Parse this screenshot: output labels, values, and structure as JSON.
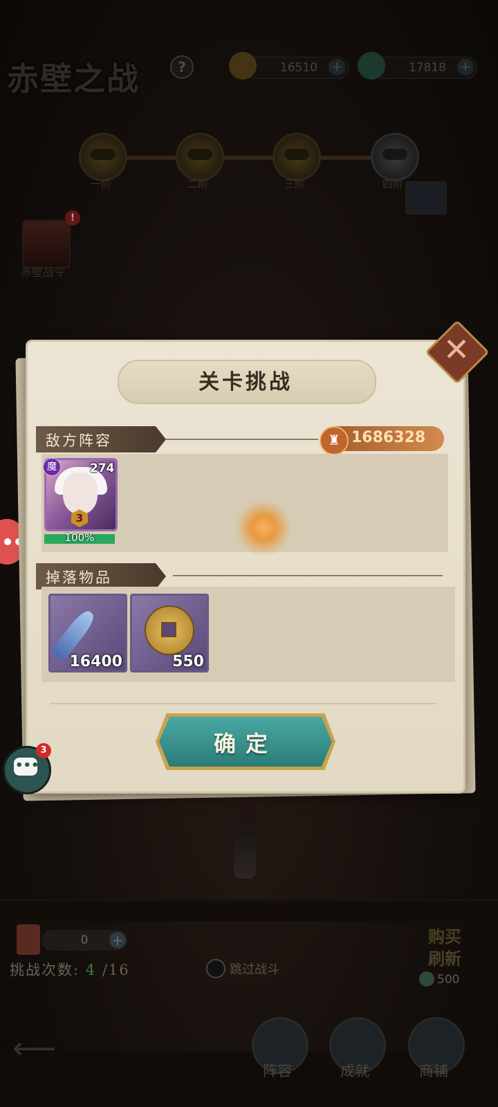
{
  "header": {
    "title": "赤壁之战",
    "help_icon": "?",
    "currency1": {
      "icon": "coin-icon",
      "value": "16510",
      "plus": "+"
    },
    "currency2": {
      "icon": "jade-dragon-icon",
      "value": "17818",
      "plus": "+"
    }
  },
  "stages": [
    {
      "label": "一阶",
      "locked": false
    },
    {
      "label": "二阶",
      "locked": false
    },
    {
      "label": "三阶",
      "locked": false
    },
    {
      "label": "四阶",
      "locked": true
    }
  ],
  "side_event": {
    "label": "赤壁战令",
    "badge": "!"
  },
  "dialog": {
    "title": "关卡挑战",
    "enemy_section": "敌方阵容",
    "power_icon": "power-icon",
    "power_value": "1686328",
    "enemy": {
      "faction": "魔",
      "level": "274",
      "stars": "3",
      "hp_percent": 100,
      "hp_text": "100%"
    },
    "drops_section": "掉落物品",
    "drops": [
      {
        "icon": "crystal-shard-icon",
        "quantity": "16400"
      },
      {
        "icon": "ancient-coin-icon",
        "quantity": "550"
      }
    ],
    "confirm_label": "确定",
    "close_icon": "close-icon"
  },
  "chat": {
    "badge": "3"
  },
  "bottom": {
    "tickets": "0",
    "attempts_label": "挑战次数:",
    "attempts_current": "4",
    "attempts_total": "/16",
    "skip_label": "跳过战斗",
    "buy_refresh_line1": "购买",
    "buy_refresh_line2": "刷新",
    "buy_cost": "500",
    "nav": [
      {
        "label": "阵容",
        "icon": "lineup-icon"
      },
      {
        "label": "成就",
        "icon": "achievement-icon"
      },
      {
        "label": "商铺",
        "icon": "shop-icon"
      }
    ]
  },
  "colors": {
    "accent_teal": "#2a7c78",
    "power_orange": "#c0652d",
    "hp_green": "#2aa860"
  }
}
